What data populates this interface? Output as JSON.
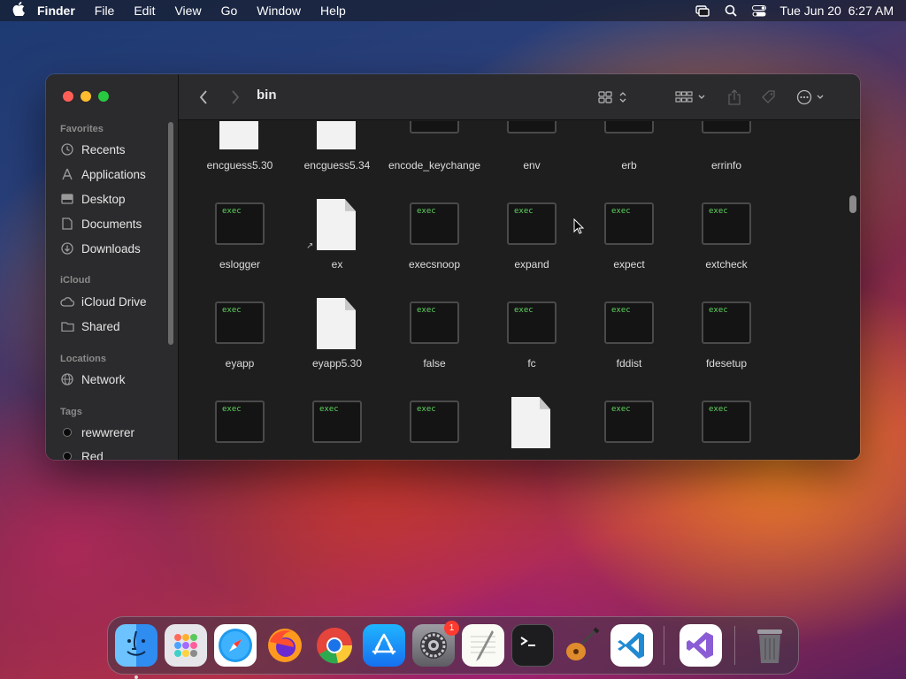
{
  "menubar": {
    "app_name": "Finder",
    "menus": [
      "File",
      "Edit",
      "View",
      "Go",
      "Window",
      "Help"
    ],
    "datetime": "Tue Jun 20  6:27 AM"
  },
  "window": {
    "title": "bin",
    "sidebar": {
      "favorites_heading": "Favorites",
      "favorites": [
        "Recents",
        "Applications",
        "Desktop",
        "Documents",
        "Downloads"
      ],
      "icloud_heading": "iCloud",
      "icloud": [
        "iCloud Drive",
        "Shared"
      ],
      "locations_heading": "Locations",
      "locations": [
        "Network"
      ],
      "tags_heading": "Tags",
      "tags": [
        "rewwrerer",
        "Red"
      ]
    },
    "files": {
      "row1": [
        "encguess5.30",
        "encguess5.34",
        "encode_keychange",
        "env",
        "erb",
        "errinfo"
      ],
      "row2": [
        "eslogger",
        "ex",
        "execsnoop",
        "expand",
        "expect",
        "extcheck"
      ],
      "row3": [
        "eyapp",
        "eyapp5.30",
        "false",
        "fc",
        "fddist",
        "fdesetup"
      ]
    },
    "exec_tag": "exec"
  },
  "dock": {
    "apps": [
      "Finder",
      "Launchpad",
      "Safari",
      "Firefox",
      "Chrome",
      "App Store",
      "System Settings",
      "TextEdit",
      "Terminal",
      "GarageBand",
      "VS Code",
      "Visual Studio",
      "Trash"
    ],
    "settings_badge": "1"
  },
  "colors": {
    "close": "#ff5f57",
    "minimize": "#febc2e",
    "zoom": "#28c840",
    "exec_text": "#5fd35f"
  }
}
